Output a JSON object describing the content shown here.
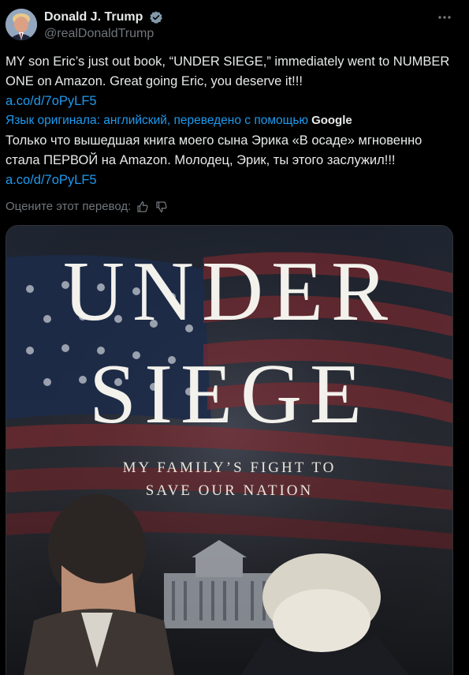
{
  "author": {
    "name": "Donald J. Trump",
    "handle": "@realDonaldTrump",
    "verified": true
  },
  "tweet": {
    "original_text": "MY son Eric’s just out book, “UNDER SIEGE,” immediately went to NUMBER ONE on Amazon. Great going Eric, you deserve it!!!",
    "original_link": "a.co/d/7oPyLF5",
    "translation_note": "Язык оригинала: английский, переведено с помощью",
    "translation_provider": "Google",
    "translated_text": "Только что вышедшая книга моего сына Эрика «В осаде» мгновенно стала ПЕРВОЙ на Amazon. Молодец, Эрик, ты этого заслужил!!!",
    "translated_link": "a.co/d/7oPyLF5",
    "rate_label": "Оцените этот перевод:"
  },
  "media": {
    "title_line1": "UNDER",
    "title_line2": "SIEGE",
    "subtitle_line1": "MY FAMILY’S FIGHT TO",
    "subtitle_line2": "SAVE OUR NATION"
  },
  "icons": {
    "verified": "verified-badge-icon",
    "more": "more-options-icon",
    "thumbs_up": "thumbs-up-icon",
    "thumbs_down": "thumbs-down-icon"
  },
  "colors": {
    "background": "#000000",
    "text": "#e7e9ea",
    "secondary": "#71767b",
    "link": "#1d9bf0",
    "border": "#2f3336"
  }
}
